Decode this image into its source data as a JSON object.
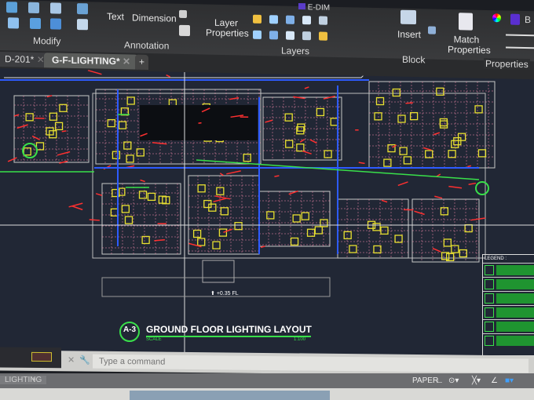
{
  "ribbon": {
    "modify": {
      "group_label": "Modify"
    },
    "annotation": {
      "text_label": "Text",
      "dimension_label": "Dimension",
      "group_label": "Annotation"
    },
    "layers": {
      "layer_properties_label": "Layer Properties",
      "group_label": "Layers",
      "current_layer": "E-DIM"
    },
    "block": {
      "insert_label": "Insert",
      "group_label": "Block"
    },
    "properties": {
      "match_properties_label": "Match Properties",
      "group_label": "Properties",
      "color_label": "B"
    }
  },
  "tabs": [
    {
      "label": "D-201*",
      "active": false
    },
    {
      "label": "G-F-LIGHTING*",
      "active": true
    }
  ],
  "new_tab_label": "+",
  "drawing": {
    "title_number": "A-3",
    "title": "GROUND FLOOR LIGHTING LAYOUT",
    "scale_label": "SCALE",
    "scale_value": "1:100",
    "level_label": "+0.35 FL",
    "legend_title": "LEGEND :"
  },
  "command_line": {
    "placeholder": "Type a command"
  },
  "layout_tab": "LIGHTING",
  "status_bar": {
    "paper_label": "PAPER"
  },
  "colors": {
    "background": "#212735",
    "ribbon": "#3a3b3d",
    "green": "#39e04a",
    "red": "#ff3030",
    "yellow": "#e8e030",
    "blue": "#2d5bff"
  }
}
